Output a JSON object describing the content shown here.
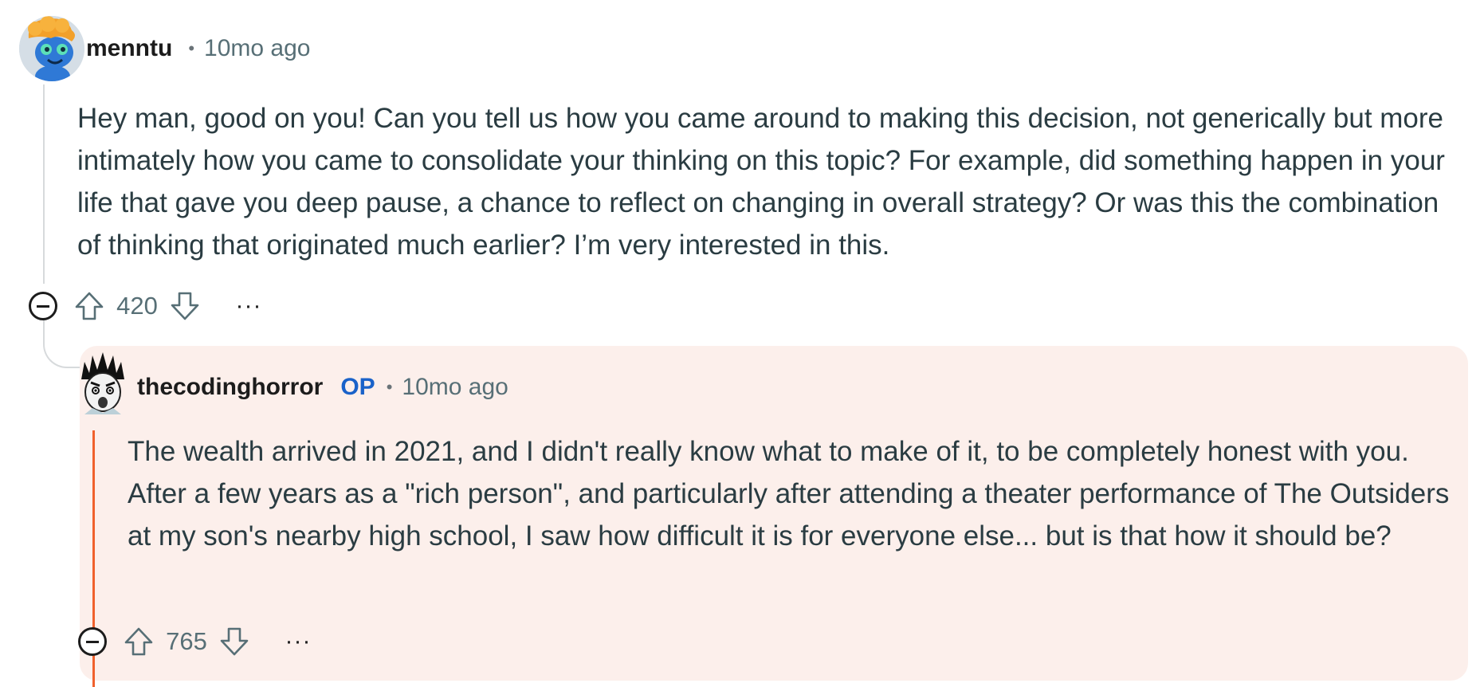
{
  "parent_comment": {
    "username": "menntu",
    "separator": "•",
    "time": "10mo ago",
    "body": "Hey man, good on you! Can you tell us how you came around to making this decision, not generically but more intimately how you came to consolidate your thinking on this topic? For example, did something happen in your life that gave you deep pause, a chance to reflect on changing in overall strategy? Or was this the combination of thinking that originated much earlier? I’m very interested in this.",
    "score": "420",
    "more_label": "···"
  },
  "reply_comment": {
    "username": "thecodinghorror",
    "badge": "OP",
    "separator": "•",
    "time": "10mo ago",
    "body": "The wealth arrived in 2021, and I didn't really know what to make of it, to be completely honest with you. After a few years as a \"rich person\", and particularly after attending a theater performance of The Outsiders at my son's nearby high school, I saw how difficult it is for everyone else... but is that how it should be?",
    "score": "765",
    "more_label": "···"
  },
  "colors": {
    "op_highlight_background": "#fcefeb",
    "op_thread_line": "#f0612d",
    "op_badge": "#1a62c9",
    "thread_line": "#d7dadc"
  }
}
